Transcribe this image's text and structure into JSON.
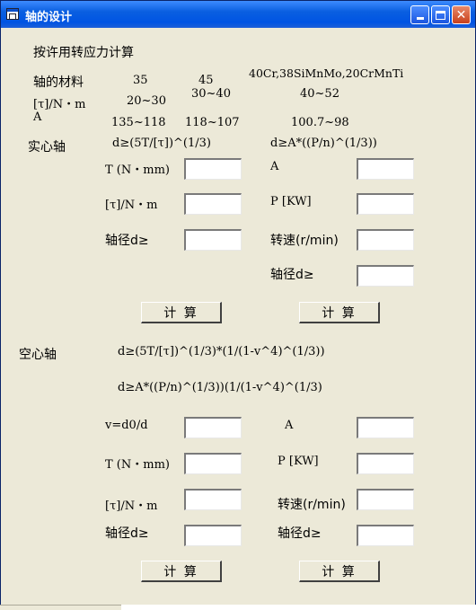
{
  "window": {
    "title": "轴的设计",
    "buttons": {
      "minimize": "_",
      "maximize": "□",
      "close": "✕"
    }
  },
  "header": {
    "heading": "按许用转应力计算",
    "material_label": "轴的材料",
    "tau_label": "[τ]/N・m",
    "A_label": "A",
    "materials": [
      "35",
      "45",
      "40Cr,38SiMnMo,20CrMnTi"
    ],
    "tau_values": [
      "20~30",
      "30~40",
      "40~52"
    ],
    "A_values": [
      "135~118",
      "118~107",
      "100.7~98"
    ]
  },
  "solid": {
    "title": "实心轴",
    "formula1": "d≥(5T/[τ])^(1/3)",
    "formula2": "d≥A*((P/n)^(1/3))",
    "left_labels": [
      "T (N・mm)",
      "[τ]/N・m",
      "轴径d≥"
    ],
    "right_labels": [
      "A",
      "P [KW]",
      "转速(r/min)",
      "轴径d≥"
    ],
    "calc_label": "计 算"
  },
  "hollow": {
    "title": "空心轴",
    "formula1": "d≥(5T/[τ])^(1/3)*(1/(1-v^4)^(1/3))",
    "formula2": "d≥A*((P/n)^(1/3))(1/(1-v^4)^(1/3)",
    "left_labels": [
      "v=d0/d",
      "T (N・mm)",
      "[τ]/N・m",
      "轴径d≥"
    ],
    "right_labels": [
      "A",
      "P [KW]",
      "转速(r/min)",
      "轴径d≥"
    ],
    "calc_label": "计 算"
  }
}
